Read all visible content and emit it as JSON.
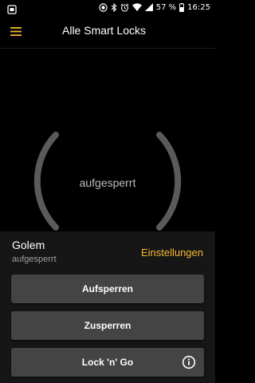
{
  "status_bar": {
    "battery_percent": "57 %",
    "time": "16:25",
    "icons": [
      "notification-app-icon",
      "record-icon",
      "bluetooth-icon",
      "alarm-icon",
      "wifi-icon",
      "signal-icon",
      "battery-icon"
    ]
  },
  "app_bar": {
    "menu_icon": "hamburger-menu-icon",
    "title": "Alle Smart Locks"
  },
  "lock_ring": {
    "state_label": "aufgesperrt"
  },
  "device": {
    "name": "Golem",
    "status": "aufgesperrt",
    "settings_label": "Einstellungen"
  },
  "actions": {
    "unlock_label": "Aufsperren",
    "lock_label": "Zusperren",
    "lock_n_go_label": "Lock 'n' Go",
    "lock_n_go_icon": "info-icon"
  },
  "colors": {
    "accent": "#f5b82e",
    "background": "#000000",
    "panel": "#161616",
    "button": "#444444",
    "ring": "#5a5a5a"
  }
}
